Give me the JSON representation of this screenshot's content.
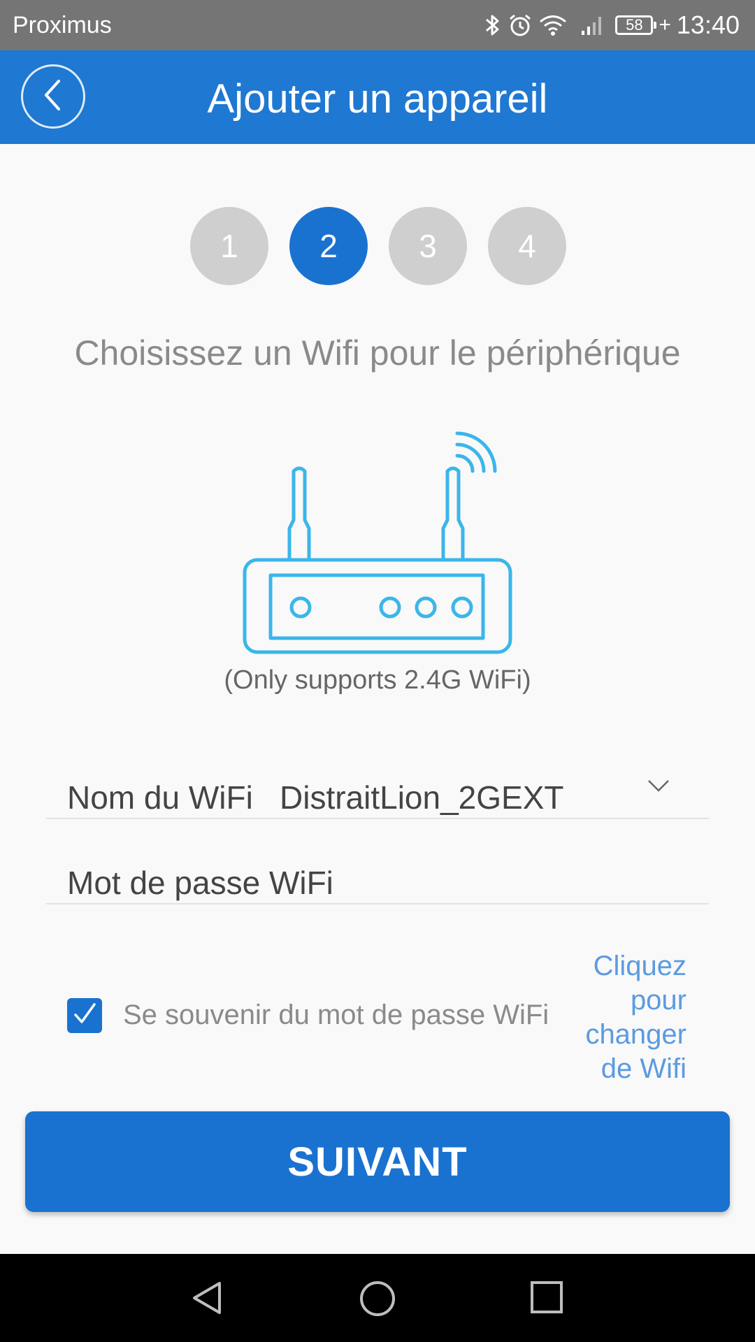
{
  "status_bar": {
    "carrier": "Proximus",
    "battery": "58",
    "time": "13:40",
    "icons": [
      "bluetooth-icon",
      "alarm-icon",
      "wifi-icon",
      "signal-icon",
      "battery-icon"
    ]
  },
  "app_bar": {
    "title": "Ajouter un appareil",
    "back_icon": "chevron-left-icon"
  },
  "stepper": {
    "steps": [
      {
        "label": "1",
        "active": false
      },
      {
        "label": "2",
        "active": true
      },
      {
        "label": "3",
        "active": false
      },
      {
        "label": "4",
        "active": false
      }
    ]
  },
  "main": {
    "heading": "Choisissez un Wifi pour le périphérique",
    "illustration": "router-icon",
    "support_note": "(Only supports 2.4G WiFi)"
  },
  "form": {
    "ssid_label": "Nom du WiFi",
    "ssid_value": "DistraitLion_2GEXT",
    "password_placeholder": "Mot de passe WiFi",
    "remember_label": "Se souvenir du mot de passe WiFi",
    "remember_checked": true,
    "change_wifi_lines": [
      "Cliquez",
      "pour",
      "changer",
      "de Wifi"
    ]
  },
  "actions": {
    "next_label": "SUIVANT"
  },
  "nav_bar": {
    "icons": [
      "back-triangle-icon",
      "home-circle-icon",
      "recents-square-icon"
    ]
  },
  "colors": {
    "primary": "#1a72d0",
    "app_bar": "#1f78d1",
    "router_line": "#3bb6ea",
    "step_inactive": "#cfcfcf",
    "link": "#5b9be0"
  }
}
